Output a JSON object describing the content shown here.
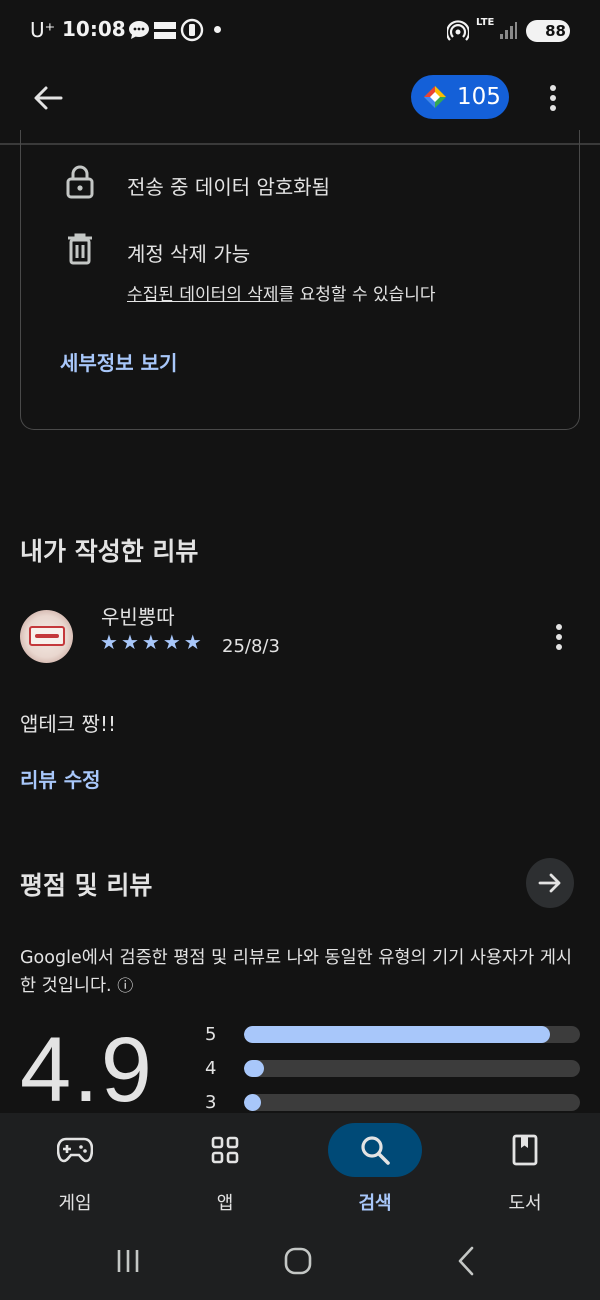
{
  "status_bar": {
    "carrier": "U⁺",
    "time": "10:08",
    "lte": "LTE",
    "battery": "88"
  },
  "header": {
    "points": "105"
  },
  "data_safety": {
    "encrypted": "전송 중 데이터 암호화됨",
    "deletable_title": "계정 삭제 가능",
    "deletable_sub_part1": "수집된 데이터의 삭제",
    "deletable_sub_part2": "를 요청할 수 있습니다",
    "details_link": "세부정보 보기"
  },
  "my_review": {
    "section_title": "내가 작성한 리뷰",
    "author": "우빈뿡따",
    "stars": 5,
    "date": "25/8/3",
    "text": "앱테크 짱!!",
    "edit_link": "리뷰 수정"
  },
  "ratings": {
    "section_title": "평점 및 리뷰",
    "description": "Google에서 검증한 평점 및 리뷰로 나와 동일한 유형의 기기 사용자가 게시한 것입니다.",
    "info_icon": "ⓘ",
    "average": "4.9",
    "bars": [
      {
        "label": "5",
        "fraction": 0.91
      },
      {
        "label": "4",
        "fraction": 0.06
      },
      {
        "label": "3",
        "fraction": 0.02
      }
    ],
    "bar_fill_color": "#a8c7fa"
  },
  "bottom_nav": {
    "items": [
      {
        "label": "게임",
        "icon": "gamepad-icon"
      },
      {
        "label": "앱",
        "icon": "apps-grid-icon"
      },
      {
        "label": "검색",
        "icon": "search-icon",
        "active": true
      },
      {
        "label": "도서",
        "icon": "book-icon"
      }
    ]
  },
  "colors": {
    "background": "#131313",
    "accent": "#a8c7fa",
    "points_pill": "#1460d8",
    "nav_active": "#004a77"
  }
}
